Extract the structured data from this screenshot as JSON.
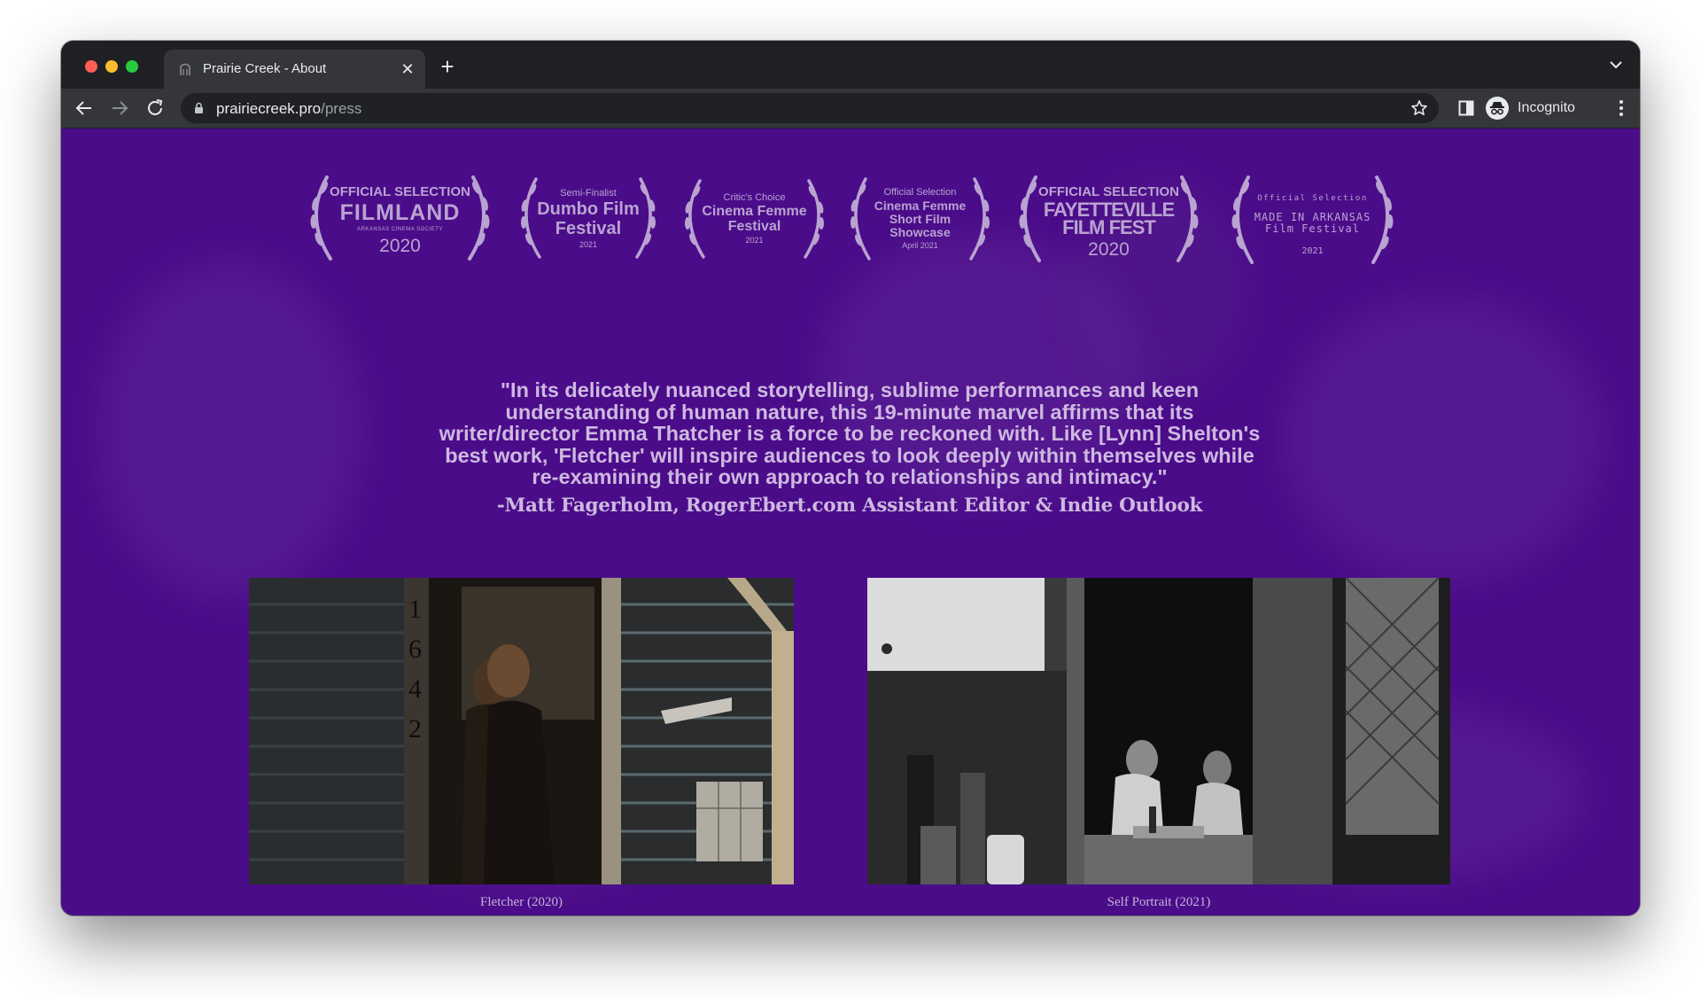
{
  "browser": {
    "tab_title": "Prairie Creek - About",
    "url_host": "prairiecreek.pro",
    "url_path": "/press",
    "profile_label": "Incognito"
  },
  "laurels": [
    {
      "top": "OFFICIAL SELECTION",
      "main": "FILMLAND",
      "sub": "ARKANSAS CINEMA SOCIETY",
      "year": "2020"
    },
    {
      "top": "Semi-Finalist",
      "main1": "Dumbo Film",
      "main2": "Festival",
      "year": "2021"
    },
    {
      "top": "Critic's Choice",
      "main1": "Cinema Femme",
      "main2": "Festival",
      "year": "2021"
    },
    {
      "top": "Official Selection",
      "main1": "Cinema Femme",
      "main2": "Short Film",
      "main3": "Showcase",
      "year": "April 2021"
    },
    {
      "top": "OFFICIAL SELECTION",
      "main1": "FAYETTEVILLE",
      "main2": "FILM FEST",
      "year": "2020"
    },
    {
      "top": "Official Selection",
      "main1": "MADE IN ARKANSAS",
      "main2": "Film Festival",
      "year": "2021"
    }
  ],
  "quote": {
    "lines": [
      "\"In its delicately nuanced storytelling, sublime performances and keen",
      "understanding of human nature, this 19-minute marvel affirms that its",
      "writer/director Emma Thatcher is a force to be reckoned with. Like [Lynn] Shelton's",
      "best work, 'Fletcher' will inspire audiences to look deeply within themselves while",
      "re-examining their own approach to relationships and intimacy.\""
    ],
    "attribution": "-Matt Fagerholm, RogerEbert.com Assistant Editor & Indie Outlook"
  },
  "stills": [
    {
      "caption": "Fletcher (2020)"
    },
    {
      "caption": "Self Portrait (2021)"
    }
  ],
  "colors": {
    "page_background": "#4b0c8a",
    "laurel_text": "#b9a3d0",
    "quote_text": "#cdb9e0"
  }
}
